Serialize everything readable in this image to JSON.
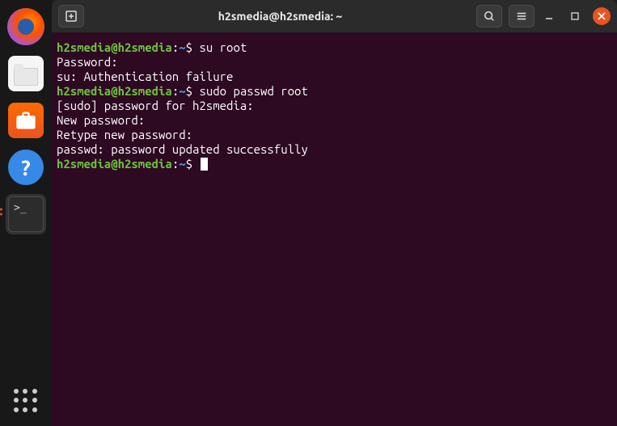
{
  "window": {
    "title": "h2smedia@h2smedia: ~"
  },
  "prompt": {
    "user": "h2smedia",
    "host": "h2smedia",
    "path": "~",
    "symbol": "$"
  },
  "terminal": {
    "cmd1": "su root",
    "out1": "Password:",
    "out2": "su: Authentication failure",
    "cmd2": "sudo passwd root",
    "out3": "[sudo] password for h2smedia:",
    "out4": "New password:",
    "out5": "Retype new password:",
    "out6": "passwd: password updated successfully"
  },
  "dock": {
    "firefox": "firefox",
    "files": "files",
    "software": "ubuntu-software",
    "help": "help",
    "terminal": "terminal",
    "apps": "show-applications"
  },
  "titlebar": {
    "new_tab": "new-tab",
    "search": "search",
    "menu": "menu",
    "minimize": "minimize",
    "maximize": "maximize",
    "close": "close"
  }
}
